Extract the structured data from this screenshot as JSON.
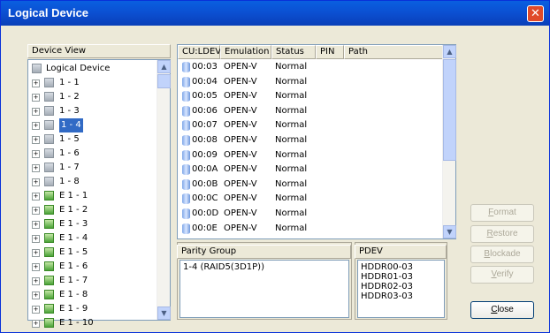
{
  "window": {
    "title": "Logical Device"
  },
  "device_view": {
    "label": "Device View",
    "root": "Logical Device",
    "items": [
      {
        "label": "1 - 1",
        "type": "gray"
      },
      {
        "label": "1 - 2",
        "type": "gray"
      },
      {
        "label": "1 - 3",
        "type": "gray"
      },
      {
        "label": "1 - 4",
        "type": "gray",
        "selected": true
      },
      {
        "label": "1 - 5",
        "type": "gray"
      },
      {
        "label": "1 - 6",
        "type": "gray"
      },
      {
        "label": "1 - 7",
        "type": "gray"
      },
      {
        "label": "1 - 8",
        "type": "gray"
      },
      {
        "label": "E 1 - 1",
        "type": "green"
      },
      {
        "label": "E 1 - 2",
        "type": "green"
      },
      {
        "label": "E 1 - 3",
        "type": "green"
      },
      {
        "label": "E 1 - 4",
        "type": "green"
      },
      {
        "label": "E 1 - 5",
        "type": "green"
      },
      {
        "label": "E 1 - 6",
        "type": "green"
      },
      {
        "label": "E 1 - 7",
        "type": "green"
      },
      {
        "label": "E 1 - 8",
        "type": "green"
      },
      {
        "label": "E 1 - 9",
        "type": "green"
      },
      {
        "label": "E 1 - 10",
        "type": "green"
      }
    ]
  },
  "ldev_table": {
    "columns": [
      "CU:LDEV",
      "Emulation",
      "Status",
      "PIN",
      "Path"
    ],
    "rows": [
      [
        "00:03",
        "OPEN-V",
        "Normal"
      ],
      [
        "00:04",
        "OPEN-V",
        "Normal"
      ],
      [
        "00:05",
        "OPEN-V",
        "Normal"
      ],
      [
        "00:06",
        "OPEN-V",
        "Normal"
      ],
      [
        "00:07",
        "OPEN-V",
        "Normal"
      ],
      [
        "00:08",
        "OPEN-V",
        "Normal"
      ],
      [
        "00:09",
        "OPEN-V",
        "Normal"
      ],
      [
        "00:0A",
        "OPEN-V",
        "Normal"
      ],
      [
        "00:0B",
        "OPEN-V",
        "Normal"
      ],
      [
        "00:0C",
        "OPEN-V",
        "Normal"
      ],
      [
        "00:0D",
        "OPEN-V",
        "Normal"
      ],
      [
        "00:0E",
        "OPEN-V",
        "Normal"
      ]
    ]
  },
  "parity_group": {
    "label": "Parity Group",
    "value": "1-4 (RAID5(3D1P))"
  },
  "pdev": {
    "label": "PDEV",
    "values": [
      "HDDR00-03",
      "HDDR01-03",
      "HDDR02-03",
      "HDDR03-03"
    ]
  },
  "buttons": {
    "format": {
      "pre": "",
      "u": "F",
      "post": "ormat"
    },
    "restore": {
      "pre": "",
      "u": "R",
      "post": "estore"
    },
    "blockade": {
      "pre": "",
      "u": "B",
      "post": "lockade"
    },
    "verify": {
      "pre": "",
      "u": "V",
      "post": "erify"
    },
    "close": {
      "pre": "",
      "u": "C",
      "post": "lose"
    }
  },
  "colors": {
    "title_bar": "#0b4fd1",
    "selection": "#316ac5"
  }
}
